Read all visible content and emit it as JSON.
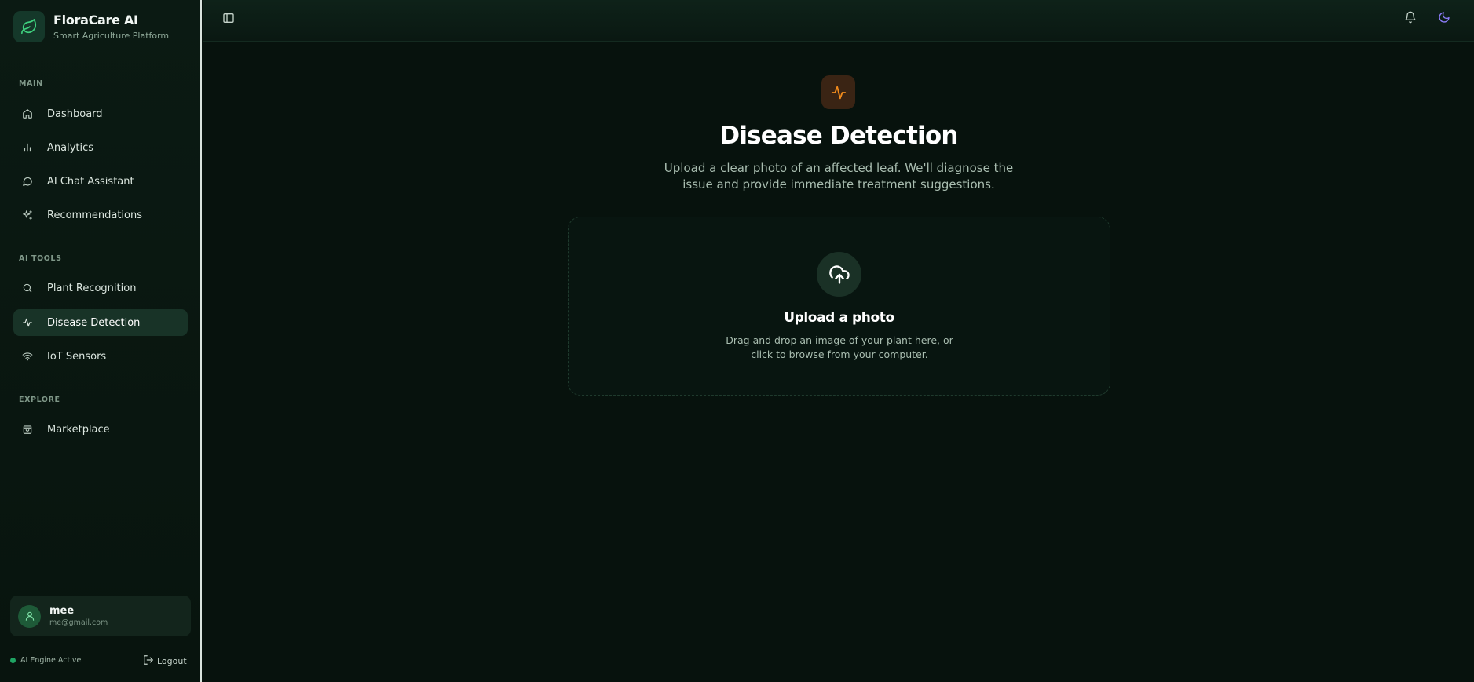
{
  "brand": {
    "title": "FloraCare AI",
    "subtitle": "Smart Agriculture Platform"
  },
  "sidebar": {
    "sections": [
      {
        "label": "MAIN"
      },
      {
        "label": "AI TOOLS"
      },
      {
        "label": "EXPLORE"
      }
    ],
    "items": [
      {
        "label": "Dashboard",
        "icon": "home-icon"
      },
      {
        "label": "Analytics",
        "icon": "bar-chart-icon"
      },
      {
        "label": "AI Chat Assistant",
        "icon": "chat-bubble-icon"
      },
      {
        "label": "Recommendations",
        "icon": "sparkles-icon"
      },
      {
        "label": "Plant Recognition",
        "icon": "search-icon"
      },
      {
        "label": "Disease Detection",
        "icon": "activity-icon",
        "active": true
      },
      {
        "label": "IoT Sensors",
        "icon": "wifi-icon"
      },
      {
        "label": "Marketplace",
        "icon": "shopping-bag-icon"
      }
    ]
  },
  "user": {
    "name": "mee",
    "email": "me@gmail.com"
  },
  "status": {
    "text": "AI Engine Active"
  },
  "logout": {
    "label": "Logout"
  },
  "main": {
    "title": "Disease Detection",
    "description": "Upload a clear photo of an affected leaf. We'll diagnose the issue and provide immediate treatment suggestions.",
    "upload": {
      "title": "Upload a photo",
      "hint": "Drag and drop an image of your plant here, or click to browse from your computer."
    }
  },
  "colors": {
    "accent": "#1fa463",
    "active_bg": "#183327",
    "warning_icon": "#f08a1c",
    "moon_icon": "#8b7cf6"
  }
}
